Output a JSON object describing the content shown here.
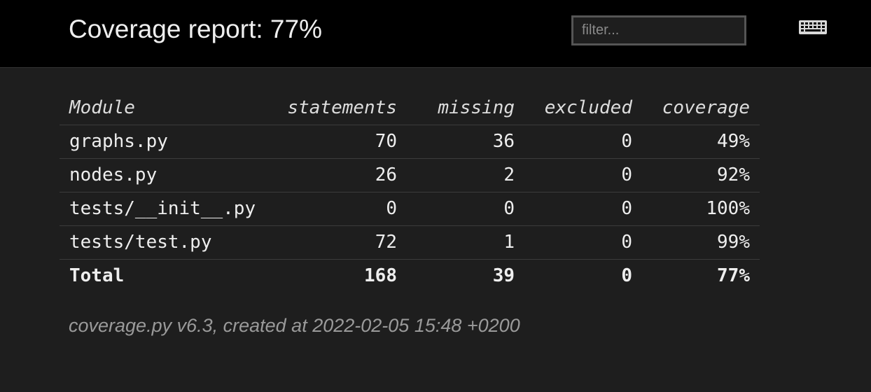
{
  "header": {
    "title": "Coverage report: 77%",
    "filter_placeholder": "filter...",
    "keyboard_icon": "keyboard-icon"
  },
  "table": {
    "columns": [
      "Module",
      "statements",
      "missing",
      "excluded",
      "coverage"
    ],
    "rows": [
      {
        "module": "graphs.py",
        "statements": "70",
        "missing": "36",
        "excluded": "0",
        "coverage": "49%"
      },
      {
        "module": "nodes.py",
        "statements": "26",
        "missing": "2",
        "excluded": "0",
        "coverage": "92%"
      },
      {
        "module": "tests/__init__.py",
        "statements": "0",
        "missing": "0",
        "excluded": "0",
        "coverage": "100%"
      },
      {
        "module": "tests/test.py",
        "statements": "72",
        "missing": "1",
        "excluded": "0",
        "coverage": "99%"
      }
    ],
    "total": {
      "module": "Total",
      "statements": "168",
      "missing": "39",
      "excluded": "0",
      "coverage": "77%"
    }
  },
  "footer": {
    "text": "coverage.py v6.3, created at 2022-02-05 15:48 +0200"
  },
  "colors": {
    "header_bg": "#000000",
    "page_bg": "#1e1e1e",
    "text": "#eeeeee",
    "muted_text": "#9a9a9a"
  }
}
